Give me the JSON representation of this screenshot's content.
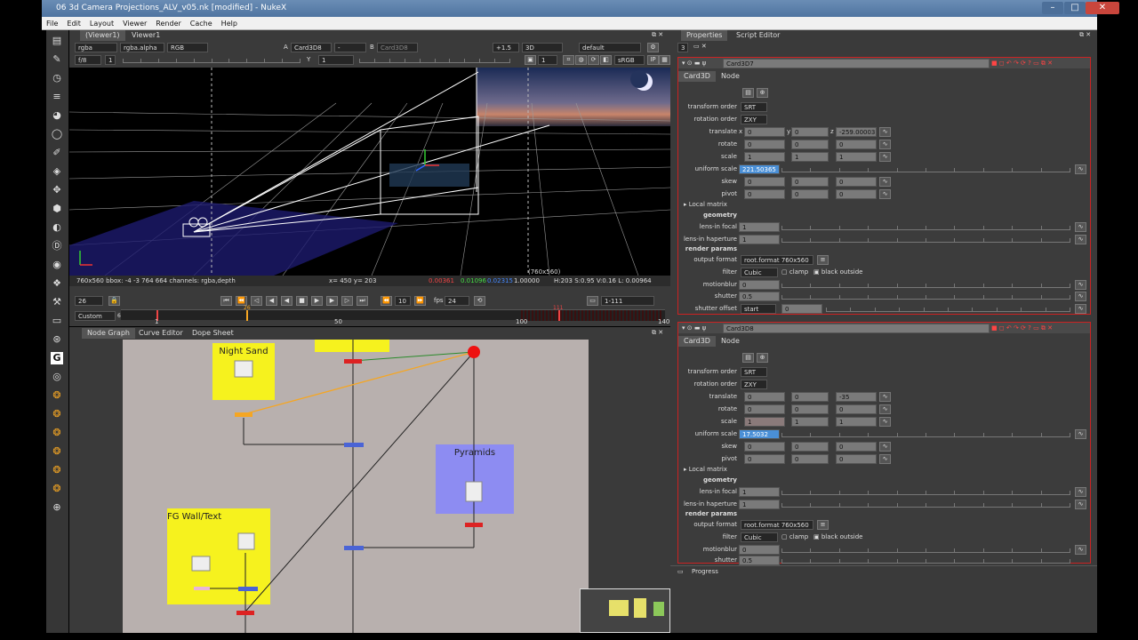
{
  "window": {
    "title": "06 3d Camera Projections_ALV_v05.nk [modified] - NukeX"
  },
  "menu": [
    "File",
    "Edit",
    "Layout",
    "Viewer",
    "Render",
    "Cache",
    "Help"
  ],
  "viewer": {
    "tabs": [
      "(Viewer1)",
      "Viewer1"
    ],
    "channels": "rgba",
    "alpha": "rgba.alpha",
    "display": "RGB",
    "input_a_label": "A",
    "input_a": "Card3D8",
    "input_dash": "-",
    "input_b_label": "B",
    "input_b": "Card3D8",
    "gain": "+1.5",
    "mode_3d": "3D",
    "camera": "default",
    "fps_label": "f/8",
    "frame_field": "1",
    "y_label": "Y",
    "y_value": "1",
    "proxy": "1",
    "colorspace": "sRGB",
    "resolution_label": "(760x560)",
    "status_info": "760x560 bbox: -4 -3 764 664 channels: rgba,depth",
    "status_xy": "x= 450 y= 203",
    "status_r": "0.00361",
    "status_g": "0.01096",
    "status_b": "0.02315",
    "status_a": "1.00000",
    "status_hsv": "H:203 S:0.95 V:0.16  L: 0.00964"
  },
  "timeline": {
    "current_frame": "26",
    "range_mode": "Custom",
    "tick_labels": [
      "1",
      "50",
      "100",
      "140"
    ],
    "start_tick": "6",
    "frame_marker": "26",
    "end_marker": "111",
    "step": "10",
    "fps_label": "fps",
    "fps": "24",
    "range": "1-111"
  },
  "node_graph": {
    "tabs": [
      "Node Graph",
      "Curve Editor",
      "Dope Sheet"
    ],
    "backdrops": [
      "Night Sand",
      "Pyramids",
      "FG Wall/Text"
    ]
  },
  "properties": {
    "tabs": [
      "Properties",
      "Script Editor"
    ],
    "count": "3",
    "progress_label": "Progress",
    "panels": [
      {
        "name": "Card3D7",
        "tabs": [
          "Card3D",
          "Node"
        ],
        "transform_order_label": "transform order",
        "transform_order": "SRT",
        "rotation_order_label": "rotation order",
        "rotation_order": "ZXY",
        "translate_label": "translate",
        "translate": [
          "0",
          "0",
          "-259.00003"
        ],
        "rotate_label": "rotate",
        "rotate": [
          "0",
          "0",
          "0"
        ],
        "scale_label": "scale",
        "scale": [
          "1",
          "1",
          "1"
        ],
        "uniform_scale_label": "uniform scale",
        "uniform_scale": "221.50365",
        "skew_label": "skew",
        "skew": [
          "0",
          "0",
          "0"
        ],
        "pivot_label": "pivot",
        "pivot": [
          "0",
          "0",
          "0"
        ],
        "local_matrix_label": "Local matrix",
        "geometry_label": "geometry",
        "lens_focal_label": "lens-in focal",
        "lens_focal": "1",
        "lens_haperture_label": "lens-in haperture",
        "lens_haperture": "1",
        "render_params_label": "render params",
        "output_format_label": "output format",
        "output_format": "root.format 760x560",
        "filter_label": "filter",
        "filter": "Cubic",
        "clamp_label": "clamp",
        "black_outside_label": "black outside",
        "motionblur_label": "motionblur",
        "motionblur": "0",
        "shutter_label": "shutter",
        "shutter": "0.5",
        "shutter_offset_label": "shutter offset",
        "shutter_offset": "start",
        "shutter_offset_value": "0"
      },
      {
        "name": "Card3D8",
        "tabs": [
          "Card3D",
          "Node"
        ],
        "transform_order_label": "transform order",
        "transform_order": "SRT",
        "rotation_order_label": "rotation order",
        "rotation_order": "ZXY",
        "translate_label": "translate",
        "translate": [
          "0",
          "0",
          "-35"
        ],
        "rotate_label": "rotate",
        "rotate": [
          "0",
          "0",
          "0"
        ],
        "scale_label": "scale",
        "scale": [
          "1",
          "1",
          "1"
        ],
        "uniform_scale_label": "uniform scale",
        "uniform_scale": "17.5032",
        "skew_label": "skew",
        "skew": [
          "0",
          "0",
          "0"
        ],
        "pivot_label": "pivot",
        "pivot": [
          "0",
          "0",
          "0"
        ],
        "local_matrix_label": "Local matrix",
        "geometry_label": "geometry",
        "lens_focal_label": "lens-in focal",
        "lens_focal": "1",
        "lens_haperture_label": "lens-in haperture",
        "lens_haperture": "1",
        "render_params_label": "render params",
        "output_format_label": "output format",
        "output_format": "root.format 760x560",
        "filter_label": "filter",
        "filter": "Cubic",
        "clamp_label": "clamp",
        "black_outside_label": "black outside",
        "motionblur_label": "motionblur",
        "motionblur": "0",
        "shutter_label": "shutter",
        "shutter": "0.5"
      }
    ]
  },
  "colors": {
    "accent_red": "#cc2222",
    "backdrop_yellow": "#f6f21e",
    "backdrop_blue": "#8d8cf2",
    "highlight": "#4a8fd6"
  }
}
